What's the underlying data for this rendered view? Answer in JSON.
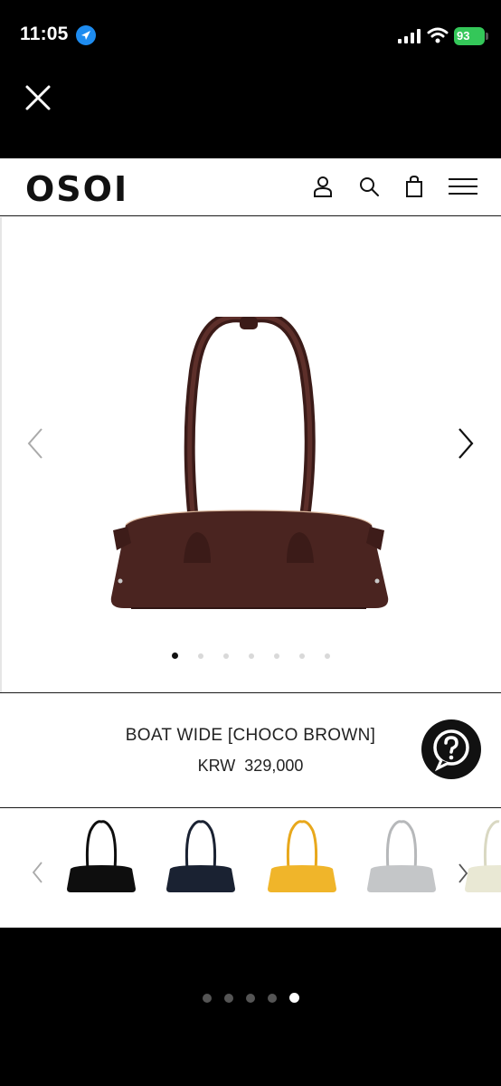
{
  "status_bar": {
    "time": "11:05",
    "battery": "93"
  },
  "site": {
    "logo": "OSOI"
  },
  "gallery": {
    "slide_count": 7,
    "active_slide": 0
  },
  "product": {
    "name": "BOAT WIDE [CHOCO BROWN]",
    "currency": "KRW",
    "price": "329,000"
  },
  "colors": {
    "main_bag": "#4a2420",
    "swatches": [
      "#0e0e0e",
      "#1a2232",
      "#f0b52a",
      "#c4c6c8",
      "#e9e8d4"
    ]
  },
  "viewer": {
    "page_count": 5,
    "active_page": 4
  }
}
